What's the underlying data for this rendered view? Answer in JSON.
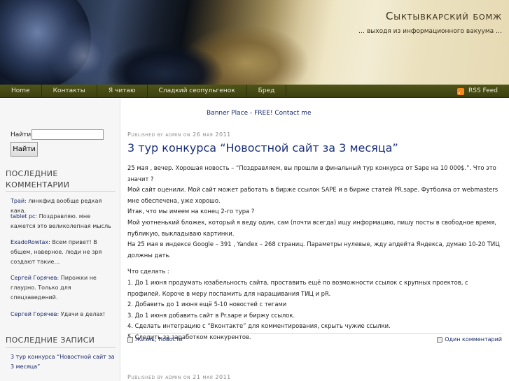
{
  "header": {
    "title": "Сыктывкарский бомж",
    "description": "… выходя из информационного вакуума …"
  },
  "nav": {
    "items": [
      "Home",
      "Контакты",
      "Я читаю",
      "Сладкий сеопульгенок",
      "Бред"
    ],
    "rss": "RSS Feed"
  },
  "sidebar": {
    "search_label": "Найти:",
    "search_value": "",
    "search_button": "Найти",
    "recent_comments_title": "Последние комментарии",
    "comments": [
      {
        "who": "Трай",
        "text": ": линкфид вообще редкая кака."
      },
      {
        "who": "tablet pc",
        "text": ": Поздравляю. мне кажется это великолепная мысль"
      },
      {
        "who": "ExadoRowtax",
        "text": ": Всем привет! В общем, наверное. люди не зря создают такие…"
      },
      {
        "who": "Сергей Горячев",
        "text": ": Пирожки не глаурно. Только для спецзаведений."
      },
      {
        "who": "Сергей Горячев",
        "text": ": Удачи в делах!"
      }
    ],
    "recent_posts_title": "Последние записи",
    "posts": [
      "3 тур конкурса “Новостной сайт за 3 месяца”"
    ]
  },
  "main": {
    "banner": "Banner Place - FREE! Contact me",
    "post": {
      "meta": "Published by admin on 26 мая 2011",
      "title": "3 тур конкурса “Новостной сайт за 3 месяца”",
      "paragraphs": [
        "25 мая , вечер. Хорошая новость – “Поздравляем, вы прошли в финальный тур конкурса от Sape на 10 000$.”. Что это значит ?",
        "Мой сайт оценили. Мой сайт может работать в бирже ссылок SAPE и в бирже статей PR.sape. Футболка от webmasters мне обеспечена, уже хорошо.",
        "Итак, что мы имеем на конец 2-го тура ?",
        "Мой уютненький бложек, который я веду один, сам (почти всегда) ищу информацию, пишу посты в свободное время, публикую, выкладываю картинки.",
        "На 25 мая в индексе Google – 391 , Yandex – 268 страниц. Параметры нулевые, жду апдейта Яндекса, думаю 10-20 ТИЦ должны дать."
      ],
      "todo_title": "Что сделать :",
      "todo": [
        "1. До 1 июня продумать юзабельность сайта, проставить ещё по возможности ссылок с крупных проектов, с профилей. Короче в меру поспамить для наращивания ТИЦ и pR.",
        "2. Добавить до 1 июня ещё 5-10 новостей с тегами",
        "3. До 1 июня добавить сайт в Pr.sape и биржу ссылок.",
        "4. Сделать интеграцию с “Вконтакте” для комментирования, скрыть чужие ссылки.",
        "5. Следить за заработком конкурентов."
      ],
      "categories": "Жизнь, Новости",
      "comments_link": "Один комментарий"
    },
    "next_meta": "Published by admin on 21 мая 2011"
  }
}
